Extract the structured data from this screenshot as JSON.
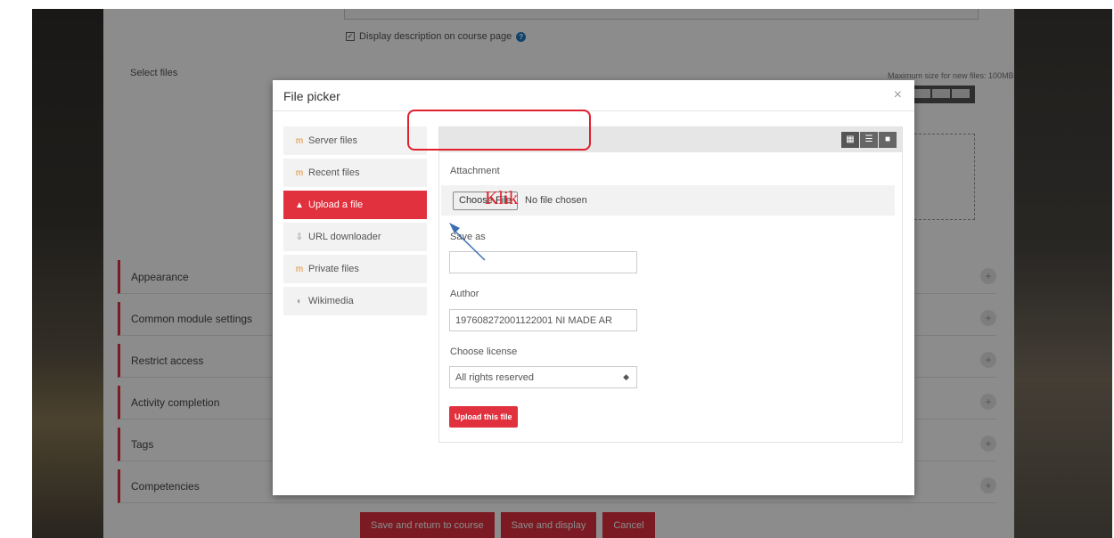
{
  "background": {
    "display_description_label": "Display description on course page",
    "select_files_label": "Select files",
    "max_size_text": "Maximum size for new files: 100MB",
    "sections": [
      {
        "label": "Appearance"
      },
      {
        "label": "Common module settings"
      },
      {
        "label": "Restrict access"
      },
      {
        "label": "Activity completion"
      },
      {
        "label": "Tags"
      },
      {
        "label": "Competencies"
      }
    ],
    "buttons": {
      "save_return": "Save and return to course",
      "save_display": "Save and display",
      "cancel": "Cancel"
    }
  },
  "modal": {
    "title": "File picker",
    "close": "×",
    "repositories": [
      {
        "label": "Server files",
        "icon": "moodle-icon",
        "active": false
      },
      {
        "label": "Recent files",
        "icon": "moodle-icon",
        "active": false
      },
      {
        "label": "Upload a file",
        "icon": "upload-icon",
        "active": true
      },
      {
        "label": "URL downloader",
        "icon": "download-icon",
        "active": false
      },
      {
        "label": "Private files",
        "icon": "moodle-icon",
        "active": false
      },
      {
        "label": "Wikimedia",
        "icon": "wikimedia-icon",
        "active": false
      }
    ],
    "form": {
      "attachment_label": "Attachment",
      "choose_file": "Choose File",
      "no_file": "No file chosen",
      "save_as_label": "Save as",
      "save_as_value": "",
      "author_label": "Author",
      "author_value": "197608272001122001 NI MADE AR",
      "license_label": "Choose license",
      "license_value": "All rights reserved",
      "upload_button": "Upload this file"
    }
  },
  "annotation": {
    "text": "Klik",
    "color": "#e0202c"
  },
  "colors": {
    "accent": "#e1303e",
    "help": "#1f7ac6"
  }
}
